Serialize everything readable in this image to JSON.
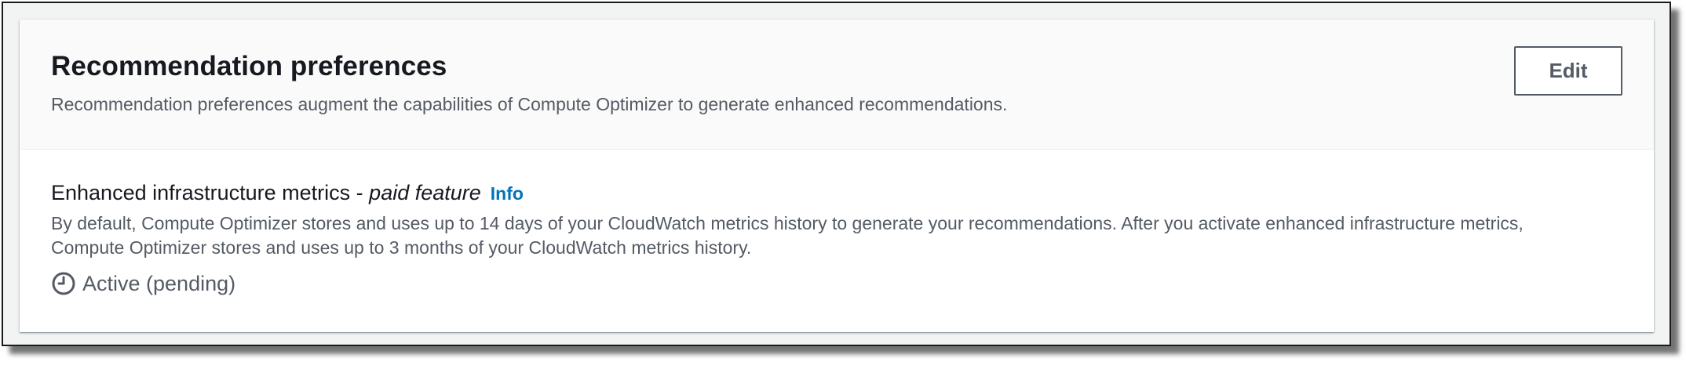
{
  "panel": {
    "title": "Recommendation preferences",
    "description": "Recommendation preferences augment the capabilities of Compute Optimizer to generate enhanced recommendations.",
    "edit_label": "Edit"
  },
  "feature": {
    "label": "Enhanced infrastructure metrics - ",
    "label_italic": "paid feature",
    "info_label": "Info",
    "description": "By default, Compute Optimizer stores and uses up to 14 days of your CloudWatch metrics history to generate your recommendations. After you activate enhanced infrastructure metrics, Compute Optimizer stores and uses up to 3 months of your CloudWatch metrics history.",
    "status_icon": "clock-icon",
    "status_text": "Active (pending)"
  },
  "colors": {
    "info_link": "#0073bb",
    "title_text": "#16191f",
    "secondary_text": "#545b64",
    "header_bg": "#fafafa"
  }
}
